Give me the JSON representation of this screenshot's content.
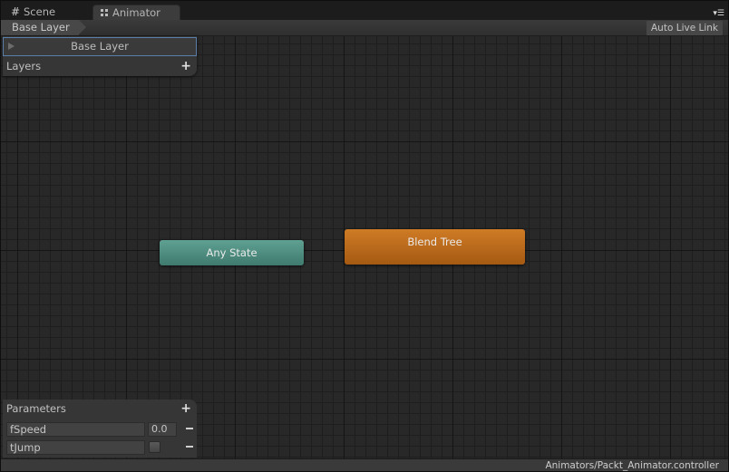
{
  "tabs": [
    {
      "label": "Scene",
      "icon": "grid-icon",
      "active": false
    },
    {
      "label": "Animator",
      "icon": "animator-icon",
      "active": true
    }
  ],
  "toolbar": {
    "breadcrumb": "Base Layer",
    "auto_live_link": "Auto Live Link"
  },
  "layers": {
    "header": "Layers",
    "add_icon": "+",
    "items": [
      {
        "label": "Base Layer",
        "selected": true
      }
    ]
  },
  "nodes": {
    "any_state": {
      "label": "Any State",
      "color": "#4f8d80"
    },
    "blend_tree": {
      "label": "Blend Tree",
      "color": "#c06a1c"
    }
  },
  "parameters": {
    "header": "Parameters",
    "add_icon": "+",
    "items": [
      {
        "name": "fSpeed",
        "type": "float",
        "value": "0.0"
      },
      {
        "name": "tJump",
        "type": "trigger",
        "value": false
      }
    ]
  },
  "status": {
    "path": "Animators/Packt_Animator.controller"
  }
}
